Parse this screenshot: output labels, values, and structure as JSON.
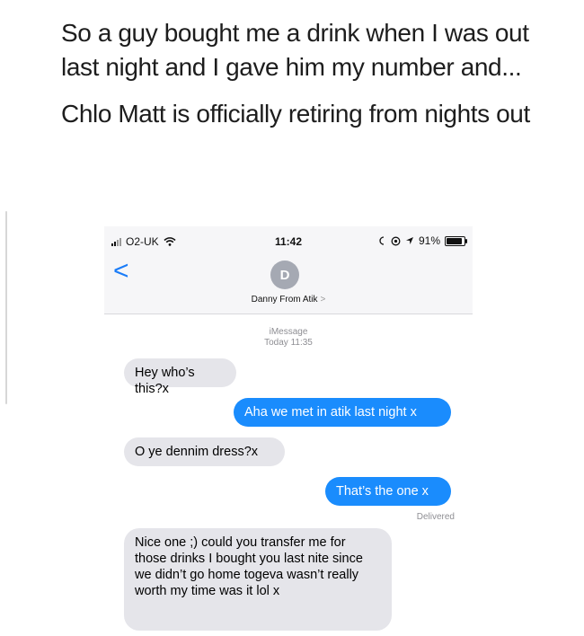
{
  "post": {
    "line1": "So a guy bought me a drink when I was out last night and I gave him my number and...",
    "line2": "Chlo Matt is officially retiring from nights out"
  },
  "status_bar": {
    "carrier": "O2-UK",
    "time": "11:42",
    "battery_percent": "91%",
    "battery_level": 0.91
  },
  "header": {
    "back": "<",
    "avatar_initial": "D",
    "contact_name": "Danny From Atik",
    "contact_chevron": ">"
  },
  "thread": {
    "service": "iMessage",
    "date_label": "Today",
    "date_time": "11:35",
    "delivered": "Delivered"
  },
  "messages": [
    {
      "from": "them",
      "text": "Hey who’s this?x"
    },
    {
      "from": "me",
      "text": "Aha we met in atik last night x"
    },
    {
      "from": "them",
      "text": "O ye dennim dress?x"
    },
    {
      "from": "me",
      "text": "That’s the one x"
    },
    {
      "from": "them",
      "text": "Nice one ;) could you transfer me for those drinks I bought you last nite since we didn’t go home togeva wasn’t really worth my time was it lol x"
    }
  ],
  "colors": {
    "ios_blue": "#1a8cfd",
    "incoming_bubble": "#e5e5ea"
  },
  "icons": {
    "signal": "signal-icon",
    "wifi": "wifi-icon",
    "alarm": "alarm-icon",
    "location": "location-icon",
    "battery": "battery-icon"
  }
}
